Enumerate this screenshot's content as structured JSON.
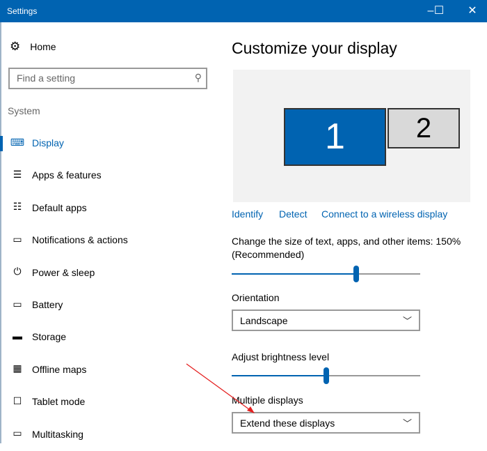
{
  "window": {
    "title": "Settings",
    "minimize": "–",
    "maximize": "☐",
    "close": "✕"
  },
  "sidebar": {
    "home": "Home",
    "search": {
      "placeholder": "Find a setting"
    },
    "section": "System",
    "items": [
      {
        "label": "Display",
        "icon": "⌨",
        "active": true
      },
      {
        "label": "Apps & features",
        "icon": "☰"
      },
      {
        "label": "Default apps",
        "icon": "☷"
      },
      {
        "label": "Notifications & actions",
        "icon": "▭"
      },
      {
        "label": "Power & sleep",
        "icon": "⏻"
      },
      {
        "label": "Battery",
        "icon": "▭"
      },
      {
        "label": "Storage",
        "icon": "▬"
      },
      {
        "label": "Offline maps",
        "icon": "▦"
      },
      {
        "label": "Tablet mode",
        "icon": "☐"
      },
      {
        "label": "Multitasking",
        "icon": "▭"
      }
    ]
  },
  "main": {
    "title": "Customize your display",
    "monitors": [
      "1",
      "2"
    ],
    "links": [
      "Identify",
      "Detect",
      "Connect to a wireless display"
    ],
    "scale_label": "Change the size of text, apps, and other items: 150%",
    "scale_sub": "(Recommended)",
    "scale_value": 0.66,
    "orientation_label": "Orientation",
    "orientation_value": "Landscape",
    "brightness_label": "Adjust brightness level",
    "brightness_value": 0.5,
    "multiple_label": "Multiple displays",
    "multiple_value": "Extend these displays"
  },
  "colors": {
    "accent": "#0063b1",
    "annotation": "#e52020"
  }
}
